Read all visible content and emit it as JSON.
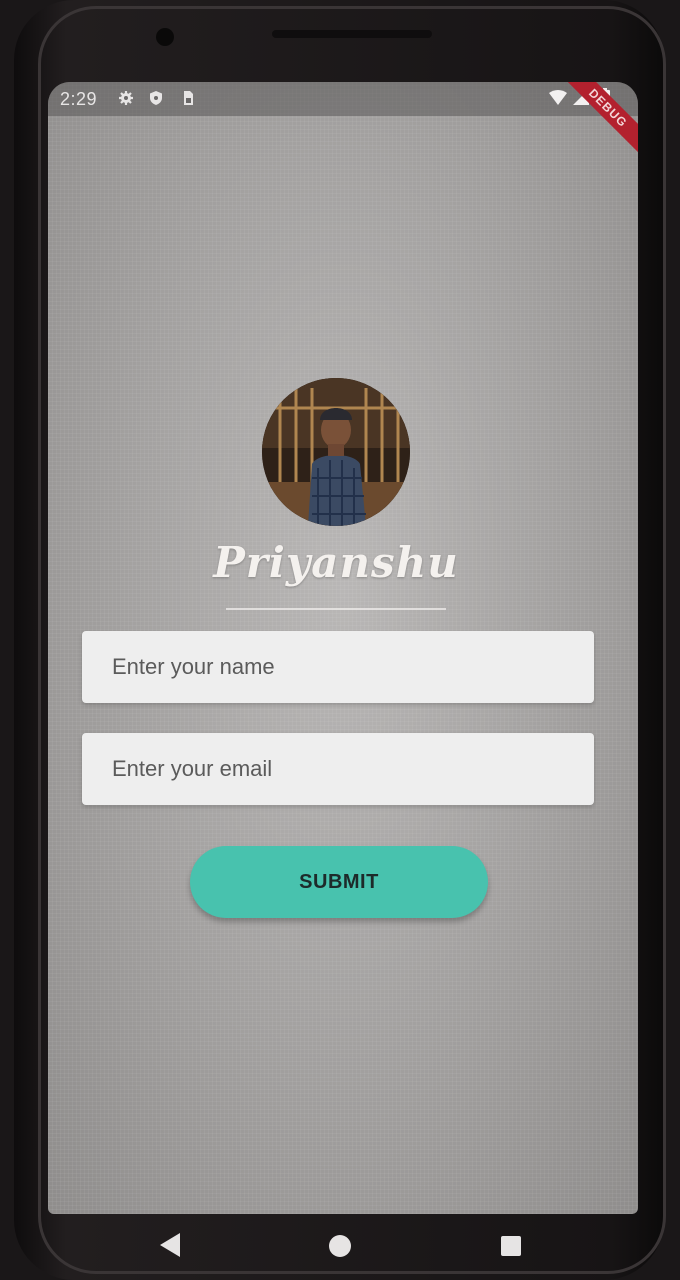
{
  "status_bar": {
    "time": "2:29",
    "icons": [
      "gear-icon",
      "shield-icon",
      "sim-icon",
      "wifi-icon",
      "signal-icon",
      "battery-icon"
    ],
    "debug_banner": "DEBUG"
  },
  "profile": {
    "avatar": "profile-photo",
    "name": "Priyanshu"
  },
  "form": {
    "name_placeholder": "Enter your name",
    "name_value": "",
    "email_placeholder": "Enter your email",
    "email_value": "",
    "submit_label": "SUBMIT"
  },
  "nav": {
    "icons": [
      "back-icon",
      "home-icon",
      "recent-apps-icon"
    ]
  },
  "colors": {
    "accent": "#48c2ae",
    "debug_banner": "#b3212e",
    "field_background": "#eeeeee"
  }
}
